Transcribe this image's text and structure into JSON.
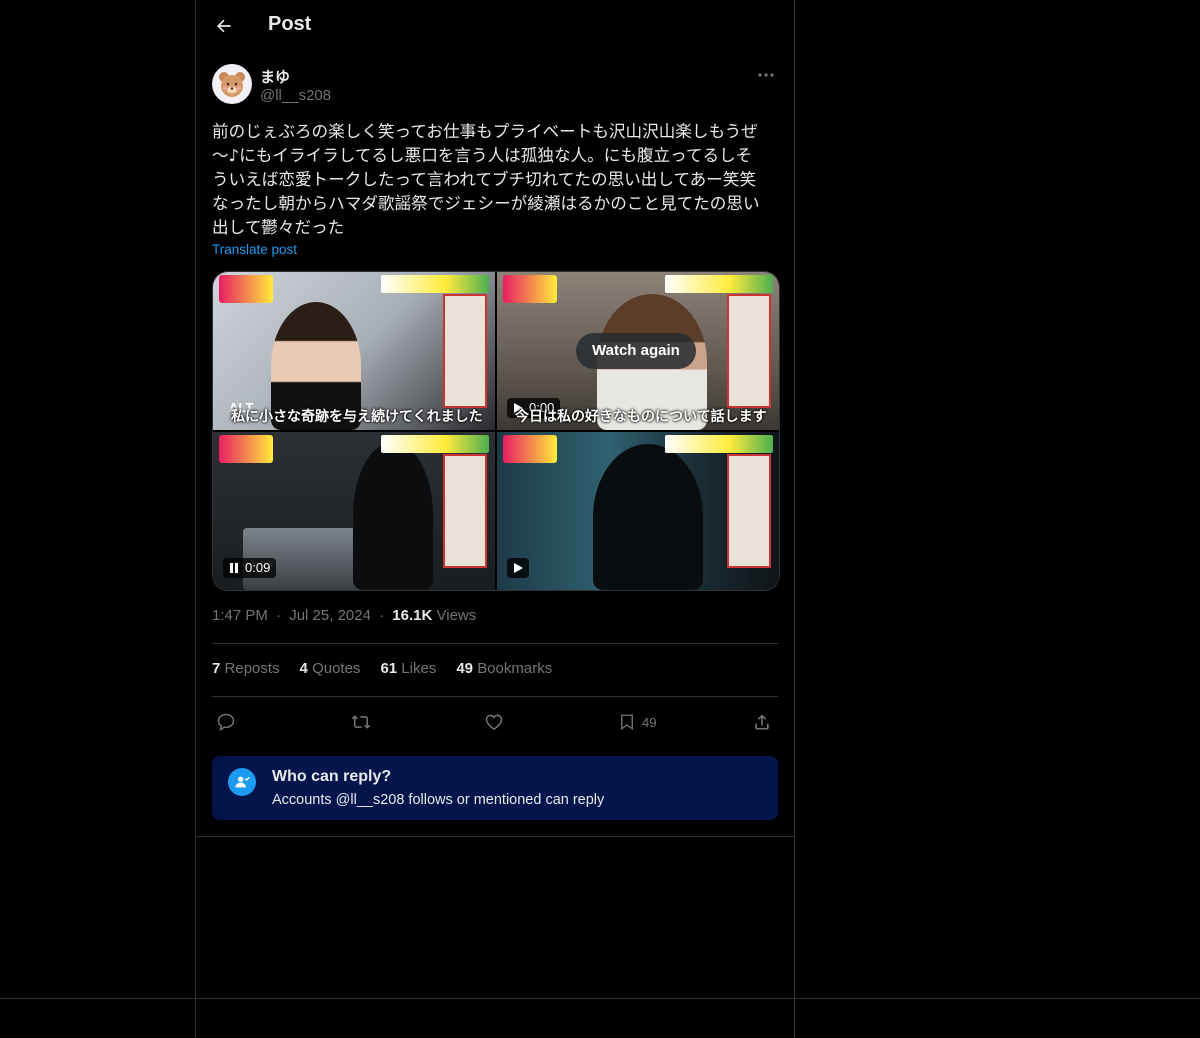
{
  "header": {
    "title": "Post"
  },
  "author": {
    "display_name": "まゆ",
    "handle": "@ll__s208"
  },
  "post": {
    "text": "前のじぇぶろの楽しく笑ってお仕事もプライベートも沢山沢山楽しもうぜ\n〜♪にもイライラしてるし悪口を言う人は孤独な人。にも腹立ってるしそ\nういえば恋愛トークしたって言われてブチ切れてたの思い出してあー笑笑\nなったし朝からハマダ歌謡祭でジェシーが綾瀬はるかのこと見てたの思い\n出して鬱々だった",
    "translate_label": "Translate post"
  },
  "media": {
    "tile1": {
      "subtitle": "私に小さな奇跡を与え続けてくれました",
      "alt_label": "ALT"
    },
    "tile2": {
      "subtitle": "今日は私の好きなものについて話します",
      "watch_again": "Watch again",
      "time": "0:00"
    },
    "tile3": {
      "time": "0:09"
    },
    "tile4": {}
  },
  "meta": {
    "time": "1:47 PM",
    "sep1": "·",
    "date": "Jul 25, 2024",
    "sep2": "·",
    "views_count": "16.1K",
    "views_label": "Views"
  },
  "stats": {
    "reposts_count": "7",
    "reposts_label": "Reposts",
    "quotes_count": "4",
    "quotes_label": "Quotes",
    "likes_count": "61",
    "likes_label": "Likes",
    "bookmarks_count": "49",
    "bookmarks_label": "Bookmarks"
  },
  "actions": {
    "bookmark_count": "49"
  },
  "reply_restriction": {
    "title": "Who can reply?",
    "subtitle": "Accounts @ll__s208 follows or mentioned can reply"
  },
  "colors": {
    "accent": "#1d9bf0",
    "text": "#e7e9ea",
    "muted": "#71767b",
    "border": "#2f3336",
    "reply_bg": "#03154a"
  }
}
